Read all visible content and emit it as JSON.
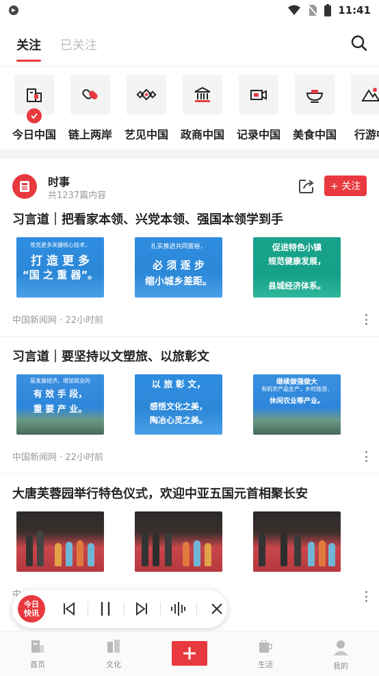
{
  "status_bar": {
    "time": "11:41"
  },
  "top_nav": {
    "tabs": [
      {
        "label": "关注",
        "active": true
      },
      {
        "label": "已关注",
        "active": false
      }
    ]
  },
  "channels": [
    {
      "label": "今日中国",
      "icon": "building-icon",
      "checked": true
    },
    {
      "label": "链上两岸",
      "icon": "chain-link-icon",
      "checked": false
    },
    {
      "label": "艺见中国",
      "icon": "ornament-icon",
      "checked": false
    },
    {
      "label": "政商中国",
      "icon": "government-hall-icon",
      "checked": false
    },
    {
      "label": "记录中国",
      "icon": "video-camera-icon",
      "checked": false
    },
    {
      "label": "美食中国",
      "icon": "food-bowl-icon",
      "checked": false
    },
    {
      "label": "行游中",
      "icon": "mountain-icon",
      "checked": false
    }
  ],
  "source": {
    "name": "时事",
    "count": "共1237篇内容",
    "follow_label": "+ 关注"
  },
  "articles": [
    {
      "title": "习言道｜把看家本领、兴党本领、强国本领学到手",
      "meta": "中国新闻网 · 22小时前",
      "thumbs": [
        {
          "kind": "text-card",
          "top": "攻克更多关键核心技术，",
          "big1": "打 造 更 多",
          "big2": "“国 之 重 器”。"
        },
        {
          "kind": "text-card",
          "top": "扎实推进共同富裕，",
          "big1": "必 须 逐 步",
          "big2": "缩小城乡差距。"
        },
        {
          "kind": "text-card-teal",
          "top": "促进特色小镇",
          "big1": "规范健康发展，",
          "big2": "县城经济体系。"
        }
      ]
    },
    {
      "title": "习言道｜要坚持以文塑旅、以旅彰文",
      "meta": "中国新闻网 · 22小时前",
      "thumbs": [
        {
          "kind": "mountain-card",
          "top": "是发展经济、增加就业的",
          "big1": "有 效 手 段，",
          "big2": "重 要 产 业。"
        },
        {
          "kind": "text-card",
          "top": "以 旅 彰 文，",
          "big1": "感悟文化之美，",
          "big2": "陶冶心灵之美。"
        },
        {
          "kind": "mountain-card",
          "top": "继续做强做大",
          "big1": "有机农产品生产，乡村旅游，",
          "big2": "休闲农业等产业。"
        }
      ]
    },
    {
      "title": "大唐芙蓉园举行特色仪式，欢迎中亚五国元首相聚长安",
      "meta": "中",
      "thumbs": [
        {
          "kind": "scene"
        },
        {
          "kind": "scene"
        },
        {
          "kind": "scene"
        }
      ]
    }
  ],
  "player": {
    "badge_line1": "今日",
    "badge_line2": "快讯"
  },
  "tab_bar": {
    "items": [
      {
        "label": "首页",
        "icon": "home-icon"
      },
      {
        "label": "文化",
        "icon": "book-icon"
      },
      {
        "label": "",
        "icon": "plus-icon"
      },
      {
        "label": "生活",
        "icon": "cup-icon"
      },
      {
        "label": "我的",
        "icon": "user-icon"
      }
    ]
  },
  "colors": {
    "accent": "#e8393f",
    "muted": "#999999",
    "channel_bg": "#f4f4f4"
  }
}
